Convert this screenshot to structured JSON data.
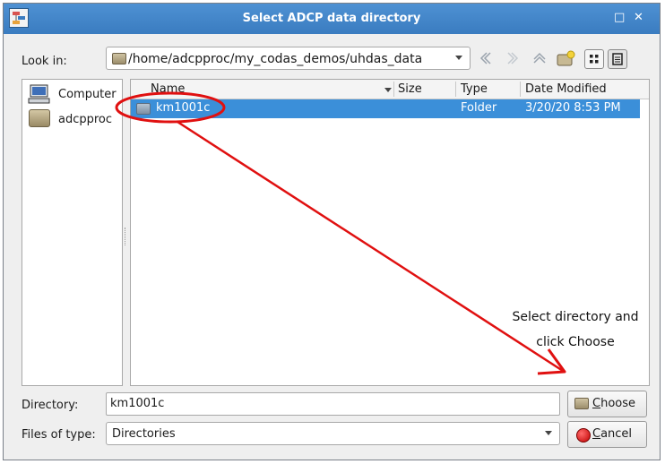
{
  "window": {
    "title": "Select ADCP data directory",
    "controls": {
      "minimize": "□",
      "close": "✕"
    }
  },
  "look_in": {
    "label": "Look in:",
    "path": "/home/adcpproc/my_codas_demos/uhdas_data"
  },
  "nav_icons": [
    "back-icon",
    "forward-icon",
    "parent-directory-icon",
    "new-folder-icon",
    "icon-view-icon",
    "detail-view-icon"
  ],
  "sidebar": {
    "items": [
      {
        "label": "Computer",
        "icon": "computer-icon"
      },
      {
        "label": "adcpproc",
        "icon": "folder-icon"
      }
    ]
  },
  "file_list": {
    "columns": [
      "Name",
      "Size",
      "Type",
      "Date Modified"
    ],
    "rows": [
      {
        "name": "km1001c",
        "size": "",
        "type": "Folder",
        "modified": "3/20/20 8:53 PM",
        "selected": true
      }
    ]
  },
  "directory": {
    "label": "Directory:",
    "value": "km1001c"
  },
  "files_of_type": {
    "label": "Files of type:",
    "value": "Directories"
  },
  "buttons": {
    "choose_first": "C",
    "choose_rest": "hoose",
    "cancel_first": "C",
    "cancel_rest": "ancel"
  },
  "annotation": {
    "line1": "Select directory and",
    "line2": "click Choose",
    "color": "#e01010"
  },
  "colors": {
    "titlebar": "#3a7cc0",
    "selection": "#3b8fd9"
  }
}
